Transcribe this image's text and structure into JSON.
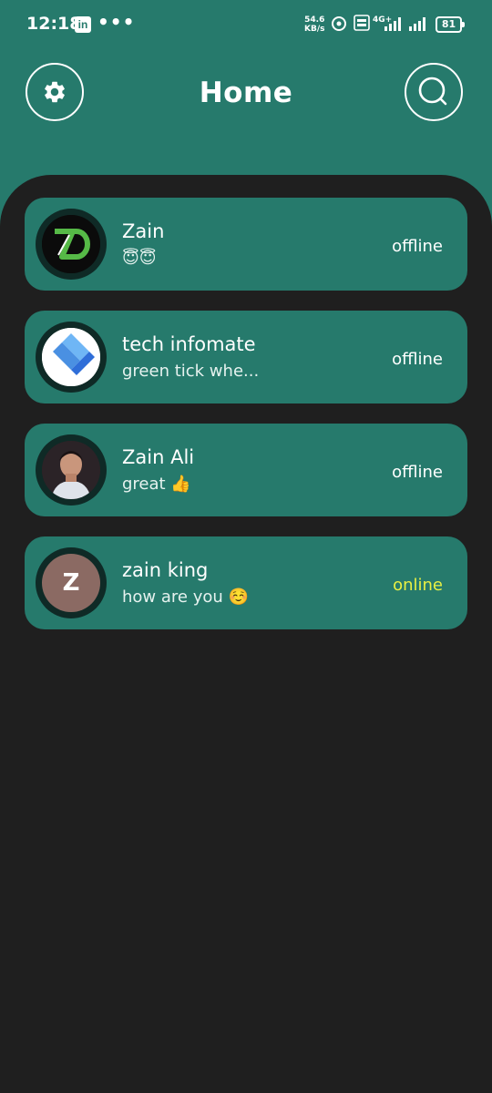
{
  "status_bar": {
    "time": "12:18",
    "linkedin_glyph": "in",
    "more": "•••",
    "speed_value": "54.6",
    "speed_unit": "KB/s",
    "network": "4G+",
    "battery": "81"
  },
  "header": {
    "title": "Home",
    "settings_icon": "gear-icon",
    "search_icon": "search-icon"
  },
  "chats": [
    {
      "name": "Zain",
      "message": "😇😇",
      "status": "offline",
      "avatar": "zd-logo"
    },
    {
      "name": "tech infomate",
      "message": "green tick whe...",
      "status": "offline",
      "avatar": "diamond-logo"
    },
    {
      "name": "Zain Ali",
      "message": "great 👍",
      "status": "offline",
      "avatar": "person-photo"
    },
    {
      "name": "zain king",
      "message": "how are you ☺️",
      "status": "online",
      "avatar": "letter",
      "avatar_letter": "Z"
    }
  ],
  "colors": {
    "header_bg": "#267a6c",
    "panel_bg": "#1f1f1f",
    "card_bg": "#267a6c",
    "online": "#e8f043",
    "offline": "#ffffff"
  }
}
